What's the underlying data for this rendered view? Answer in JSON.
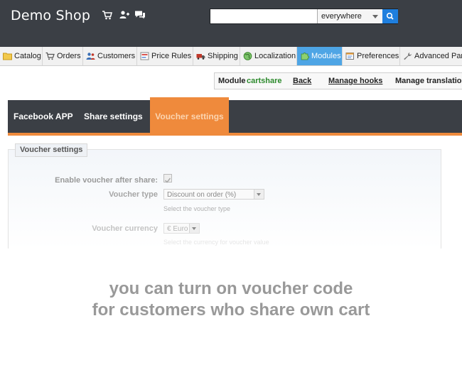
{
  "header": {
    "shop_title": "Demo Shop",
    "icons": [
      "cart-icon",
      "customers-icon",
      "messages-icon"
    ],
    "search": {
      "value": "",
      "placeholder": "",
      "scope": "everywhere"
    }
  },
  "tabs": [
    {
      "label": "Catalog",
      "icon": "folder-icon"
    },
    {
      "label": "Orders",
      "icon": "cart-icon"
    },
    {
      "label": "Customers",
      "icon": "customers-icon"
    },
    {
      "label": "Price Rules",
      "icon": "price-tag-icon"
    },
    {
      "label": "Shipping",
      "icon": "truck-icon"
    },
    {
      "label": "Localization",
      "icon": "globe-icon"
    },
    {
      "label": "Modules",
      "icon": "puzzle-icon",
      "active": true
    },
    {
      "label": "Preferences",
      "icon": "preferences-icon"
    },
    {
      "label": "Advanced Para",
      "icon": "wrench-icon"
    }
  ],
  "module_bar": {
    "module_label": "Module",
    "module_name": "cartshare",
    "back": "Back",
    "manage_hooks": "Manage hooks",
    "manage_translations": "Manage translation"
  },
  "module_tabs": [
    "Facebook APP",
    "Share settings",
    "Voucher settings"
  ],
  "voucher_form": {
    "legend": "Voucher settings",
    "enable_label": "Enable voucher after share:",
    "enable_checked": true,
    "type_label": "Voucher type",
    "type_value": "Discount on order (%)",
    "type_hint": "Select the voucher type",
    "currency_label": "Voucher currency",
    "currency_value": "€ Euro",
    "currency_hint": "Select the currency for voucher value"
  },
  "caption": {
    "line1": "you can turn on voucher code",
    "line2": "for customers who share own cart"
  },
  "colors": {
    "header_bg": "#3b3f45",
    "active_tab": "#4ea5e5",
    "accent_orange": "#ef8a3c",
    "module_green": "#2d8a2d",
    "search_button": "#1f7fde"
  }
}
